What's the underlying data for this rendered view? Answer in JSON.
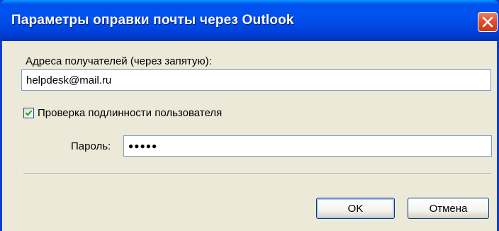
{
  "window": {
    "title": "Параметры оправки почты через Outlook"
  },
  "recipients": {
    "label": "Адреса получателей (через запятую):",
    "value": "helpdesk@mail.ru"
  },
  "auth_checkbox": {
    "label": "Проверка подлинности пользователя",
    "checked": true
  },
  "password": {
    "label": "Пароль:",
    "value": "●●●●●"
  },
  "buttons": {
    "ok_label": "OK",
    "cancel_label": "Отмена"
  },
  "icons": {
    "close": "close-icon",
    "check": "checkmark-icon"
  },
  "colors": {
    "titlebar": "#0050EE",
    "close_button": "#E0502B",
    "dialog_face": "#ECE9D8",
    "field_border": "#7F9DB9",
    "checkmark": "#21A121"
  }
}
